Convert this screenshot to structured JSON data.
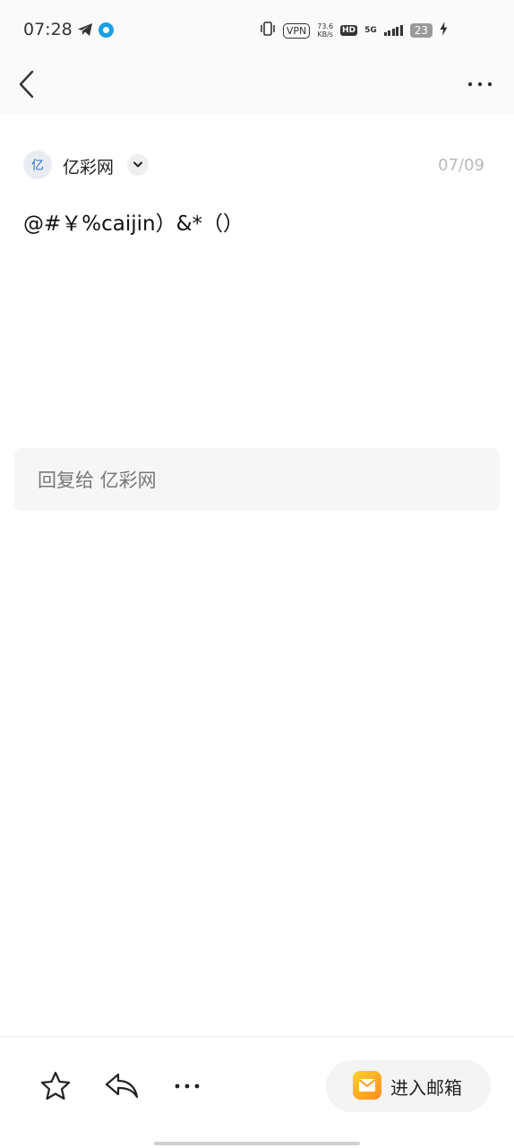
{
  "status_bar": {
    "time": "07:28",
    "vpn": "VPN",
    "speed_value": "73.6",
    "speed_unit": "KB/s",
    "hd": "HD",
    "network": "5G",
    "battery": "23",
    "icons": [
      "telegram-icon",
      "app-icon",
      "vibrate-icon",
      "signal-icon",
      "charging-icon"
    ]
  },
  "nav": {
    "back_icon": "chevron-left-icon",
    "more_icon": "more-horizontal-icon"
  },
  "email": {
    "avatar_initial": "亿",
    "sender": "亿彩网",
    "date": "07/09",
    "body": "@#￥%caijin）&*（）"
  },
  "reply": {
    "placeholder": "回复给 亿彩网"
  },
  "toolbar": {
    "icons": [
      "star-icon",
      "reply-icon",
      "more-icon",
      "mail-icon"
    ],
    "open_inbox_label": "进入邮箱"
  },
  "colors": {
    "accent": "#2f6fc2",
    "inbox_icon": "#ffb020"
  }
}
